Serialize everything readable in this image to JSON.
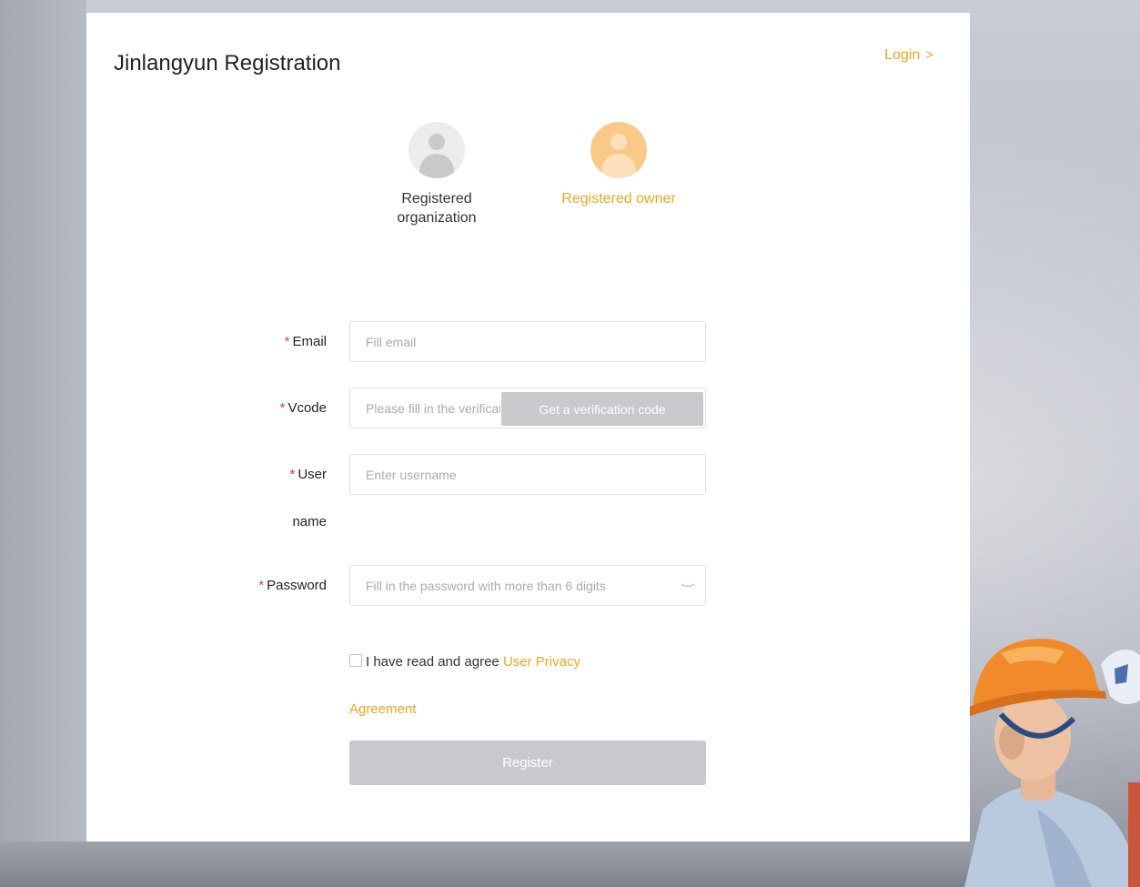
{
  "header": {
    "title": "Jinlangyun Registration",
    "login_label": "Login",
    "login_chevron": ">"
  },
  "roles": [
    {
      "label": "Registered organization",
      "selected": false,
      "icon": "user-avatar-icon"
    },
    {
      "label": "Registered owner",
      "selected": true,
      "icon": "user-avatar-icon"
    }
  ],
  "form": {
    "required_mark": "*",
    "email": {
      "label": "Email",
      "value": "",
      "placeholder": "Fill email"
    },
    "vcode": {
      "label": "Vcode",
      "value": "",
      "placeholder": "Please fill in the verification code",
      "button_label": "Get a verification code"
    },
    "username": {
      "label": "User name",
      "value": "",
      "placeholder": "Enter username"
    },
    "password": {
      "label": "Password",
      "value": "",
      "placeholder": "Fill in the password with more than 6 digits",
      "toggle_icon": "eye-closed-icon"
    }
  },
  "agreement": {
    "checked": false,
    "text": "I have read and agree",
    "link_text": "User Privacy Agreement"
  },
  "register_label": "Register",
  "colors": {
    "accent": "#f2a51f",
    "required": "#e8403a",
    "disabled_button": "#c8c9cc"
  }
}
